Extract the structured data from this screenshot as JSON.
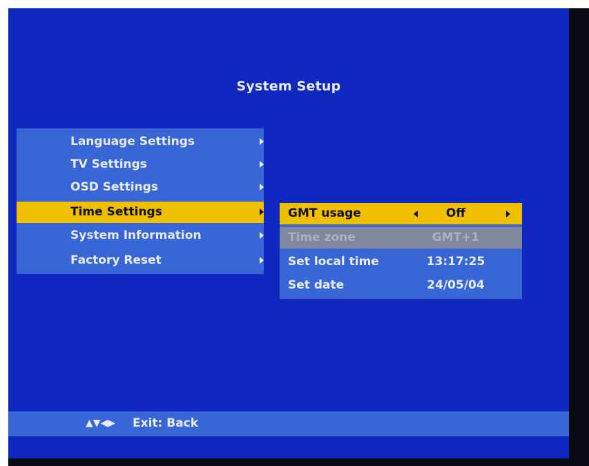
{
  "screen": {
    "title": "System Setup"
  },
  "menu": {
    "items": [
      {
        "label": "Language Settings"
      },
      {
        "label": "TV Settings"
      },
      {
        "label": "OSD Settings"
      },
      {
        "label": "Time Settings",
        "selected": true
      },
      {
        "label": "System Information"
      },
      {
        "label": "Factory Reset"
      }
    ]
  },
  "submenu": {
    "rows": [
      {
        "label": "GMT usage",
        "value": "Off",
        "selected": true
      },
      {
        "label": "Time zone",
        "value": "GMT+1",
        "disabled": true
      },
      {
        "label": "Set local time",
        "value": "13:17:25"
      },
      {
        "label": "Set date",
        "value": "24/05/04"
      }
    ]
  },
  "footer": {
    "nav_icons": "▲▼◀▶",
    "hint": "Exit: Back"
  },
  "colors": {
    "background": "#1028c0",
    "panel": "#3866d6",
    "highlight": "#f0c000",
    "disabled": "#8088a0",
    "text": "#e8ecff"
  }
}
